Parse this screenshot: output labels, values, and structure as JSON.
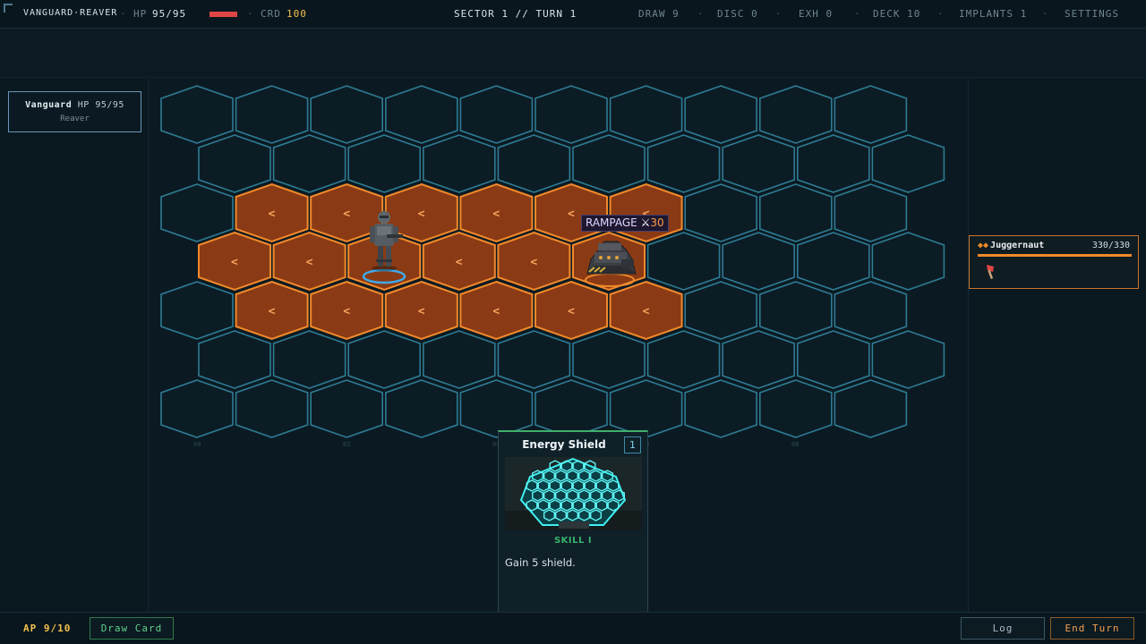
{
  "top_bar": {
    "title": "VANGUARD·REAVER",
    "hp_label": "HP",
    "hp_value": "95/95",
    "hp_fraction": 1.0,
    "credits_label": "CRD",
    "credits_value": "100",
    "sector_turn": "SECTOR 1 // TURN 1",
    "draw": "DRAW 9",
    "discard": "DISC 0",
    "exhaust": "EXH 0",
    "deck": "DECK 10",
    "implants": "IMPLANTS 1",
    "settings": "SETTINGS",
    "separator": "·"
  },
  "player_card": {
    "name": "Vanguard",
    "hp": "HP 95/95",
    "class": "Reaver"
  },
  "enemy_card": {
    "prefix": "◆◆",
    "name": "Juggernaut",
    "hp": "330/330",
    "hp_fraction": 1.0,
    "intent_icon": "axe-icon"
  },
  "enemy_intent": {
    "label": "RAMPAGE",
    "icon": "crossed-swords-icon",
    "swords_glyph": "⚔",
    "damage": "30"
  },
  "board": {
    "threat_symbol": "<",
    "column_labels": [
      "00",
      "02",
      "04",
      "06",
      "08"
    ]
  },
  "hand_card": {
    "title": "Energy Shield",
    "cost": "1",
    "type": "SKILL I",
    "description": "Gain 5 shield."
  },
  "bottom_bar": {
    "ap": "AP 9/10",
    "draw_button": "Draw Card",
    "log_button": "Log",
    "end_turn_button": "End Turn"
  },
  "colors": {
    "threat_fill": "#8a3a14",
    "threat_stroke": "#f0892c",
    "hex_stroke": "#2e7b93",
    "accent_gold": "#f2c14e",
    "skill_green": "#36b36a"
  }
}
